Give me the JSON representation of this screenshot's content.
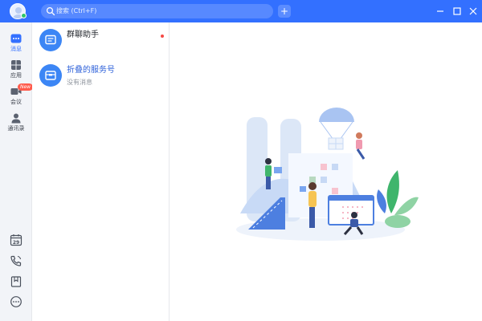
{
  "titlebar": {
    "search": {
      "placeholder": "搜索 (Ctrl+F)",
      "icon": "search-icon"
    },
    "add_label": "+",
    "color": "#3370ff"
  },
  "nav": {
    "items": [
      {
        "label": "消息",
        "icon": "message-icon",
        "active": true
      },
      {
        "label": "应用",
        "icon": "apps-icon",
        "active": false
      },
      {
        "label": "会议",
        "icon": "meeting-icon",
        "active": false,
        "badge": "New"
      },
      {
        "label": "通讯录",
        "icon": "contacts-icon",
        "active": false
      }
    ],
    "calendar_day": "29",
    "bottom_icons": [
      "calendar-icon",
      "phone-icon",
      "bookmark-icon",
      "more-icon"
    ]
  },
  "conversations": [
    {
      "title": "群聊助手",
      "subtitle": "",
      "unread": true,
      "icon": "group-assistant-icon"
    },
    {
      "title": "折叠的服务号",
      "subtitle": "没有消息",
      "unread": false,
      "icon": "folded-service-icon"
    }
  ],
  "colors": {
    "accent": "#3370ff",
    "unread": "#f54a45",
    "badge": "#ff5b4c"
  }
}
